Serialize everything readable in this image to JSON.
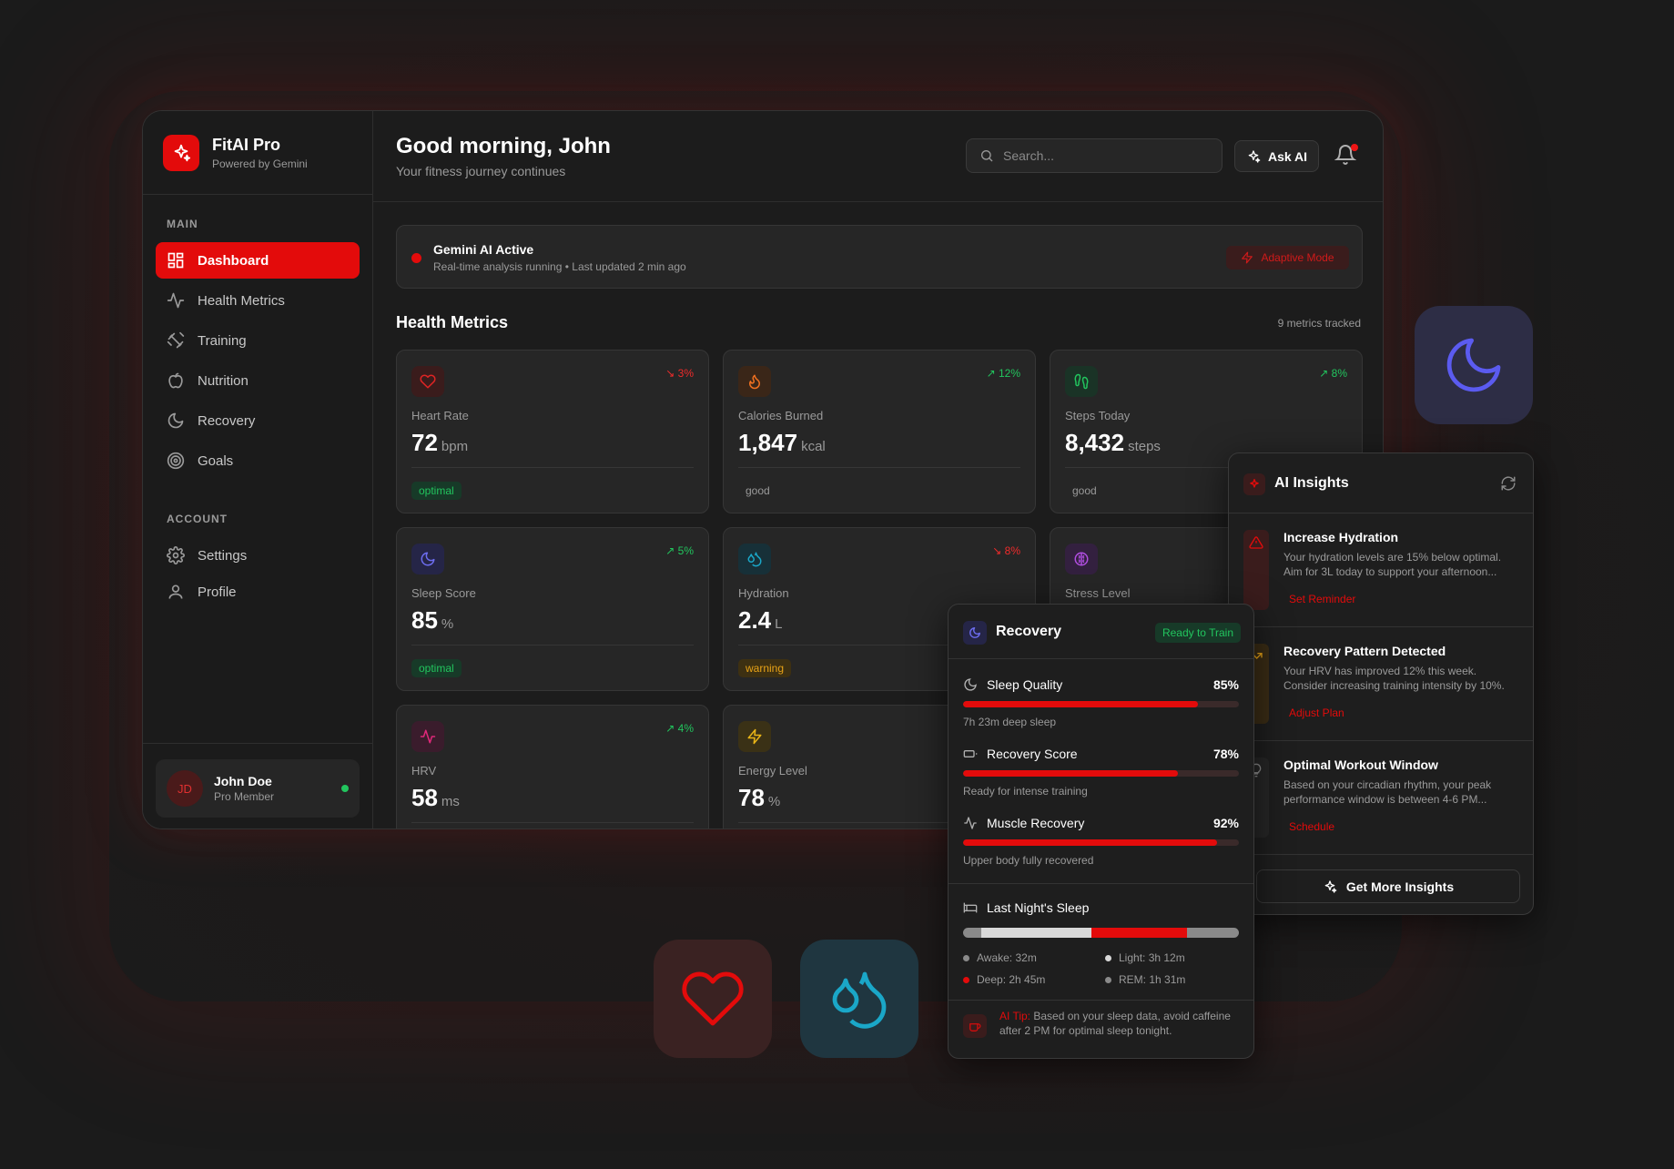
{
  "brand": {
    "name": "FitAI Pro",
    "tagline": "Powered by Gemini"
  },
  "sidebar": {
    "main_label": "MAIN",
    "main_items": [
      {
        "label": "Dashboard",
        "icon": "dashboard-icon",
        "active": true
      },
      {
        "label": "Health Metrics",
        "icon": "activity-icon"
      },
      {
        "label": "Training",
        "icon": "dumbbell-icon"
      },
      {
        "label": "Nutrition",
        "icon": "apple-icon"
      },
      {
        "label": "Recovery",
        "icon": "moon-icon"
      },
      {
        "label": "Goals",
        "icon": "target-icon"
      }
    ],
    "account_label": "ACCOUNT",
    "account_items": [
      {
        "label": "Settings",
        "icon": "gear-icon"
      },
      {
        "label": "Profile",
        "icon": "user-icon"
      }
    ],
    "user": {
      "initials": "JD",
      "name": "John Doe",
      "role": "Pro Member"
    }
  },
  "header": {
    "greeting": "Good morning, John",
    "subtitle": "Your fitness journey continues",
    "search_placeholder": "Search...",
    "ask_ai_label": "Ask AI"
  },
  "gemini": {
    "title": "Gemini AI Active",
    "subtitle": "Real-time analysis running • Last updated 2 min ago",
    "mode_label": "Adaptive Mode"
  },
  "health_metrics": {
    "title": "Health Metrics",
    "count_label": "9 metrics tracked",
    "cards": [
      {
        "label": "Heart Rate",
        "value": "72",
        "unit": "bpm",
        "trend": "3%",
        "trend_dir": "down",
        "status": "optimal",
        "icon": "heart-icon",
        "color": "#e02424"
      },
      {
        "label": "Calories Burned",
        "value": "1,847",
        "unit": "kcal",
        "trend": "12%",
        "trend_dir": "up",
        "status": "good",
        "icon": "flame-icon",
        "color": "#f07020"
      },
      {
        "label": "Steps Today",
        "value": "8,432",
        "unit": "steps",
        "trend": "8%",
        "trend_dir": "up",
        "status": "good",
        "icon": "footprints-icon",
        "color": "#22c55e"
      },
      {
        "label": "Sleep Score",
        "value": "85",
        "unit": "%",
        "trend": "5%",
        "trend_dir": "up",
        "status": "optimal",
        "icon": "moon-icon",
        "color": "#6d6df0"
      },
      {
        "label": "Hydration",
        "value": "2.4",
        "unit": "L",
        "trend": "8%",
        "trend_dir": "down",
        "status": "warning",
        "icon": "droplets-icon",
        "color": "#1aa7c8"
      },
      {
        "label": "Stress Level",
        "value": "",
        "unit": "",
        "trend": "",
        "trend_dir": "",
        "status": "",
        "icon": "brain-icon",
        "color": "#b04ee0"
      },
      {
        "label": "HRV",
        "value": "58",
        "unit": "ms",
        "trend": "4%",
        "trend_dir": "up",
        "status": "",
        "icon": "pulse-icon",
        "color": "#e0287a"
      },
      {
        "label": "Energy Level",
        "value": "78",
        "unit": "%",
        "trend": "",
        "trend_dir": "",
        "status": "",
        "icon": "bolt-icon",
        "color": "#e8b417"
      }
    ]
  },
  "recovery": {
    "title": "Recovery",
    "badge": "Ready to Train",
    "rows": [
      {
        "label": "Sleep Quality",
        "pct_label": "85%",
        "pct": 0.85,
        "note": "7h 23m deep sleep",
        "icon": "moon-icon"
      },
      {
        "label": "Recovery Score",
        "pct_label": "78%",
        "pct": 0.78,
        "note": "Ready for intense training",
        "icon": "battery-icon"
      },
      {
        "label": "Muscle Recovery",
        "pct_label": "92%",
        "pct": 0.92,
        "note": "Upper body fully recovered",
        "icon": "activity-icon"
      }
    ],
    "sleep_title": "Last Night's Sleep",
    "sleep_segments": [
      {
        "name": "Awake",
        "minutes": 32,
        "color": "#8a8a8a"
      },
      {
        "name": "Light",
        "minutes": 192,
        "color": "#d8d8d8"
      },
      {
        "name": "Deep",
        "minutes": 165,
        "color": "#e30b0b"
      },
      {
        "name": "REM",
        "minutes": 91,
        "color": "#8a8a8a"
      }
    ],
    "legend": {
      "awake": "Awake: 32m",
      "light": "Light: 3h 12m",
      "deep": "Deep: 2h 45m",
      "rem": "REM: 1h 31m"
    },
    "tip_label": "AI Tip:",
    "tip_text": " Based on your sleep data, avoid caffeine after 2 PM for optimal sleep tonight."
  },
  "insights": {
    "title": "AI Insights",
    "items": [
      {
        "title": "Increase Hydration",
        "desc": "Your hydration levels are 15% below optimal. Aim for 3L today to support your afternoon...",
        "action": "Set Reminder",
        "accent": "#3a1c1c"
      },
      {
        "title": "Recovery Pattern Detected",
        "desc": "Your HRV has improved 12% this week. Consider increasing training intensity by 10%.",
        "action": "Adjust Plan",
        "accent": "#3a2c15"
      },
      {
        "title": "Optimal Workout Window",
        "desc": "Based on your circadian rhythm, your peak performance window is between 4-6 PM...",
        "action": "Schedule",
        "accent": "#2a2a2a"
      }
    ],
    "button_label": "Get More Insights"
  },
  "colors": {
    "accent": "#e30b0b",
    "success": "#22c55e",
    "warning": "#e8a317"
  }
}
